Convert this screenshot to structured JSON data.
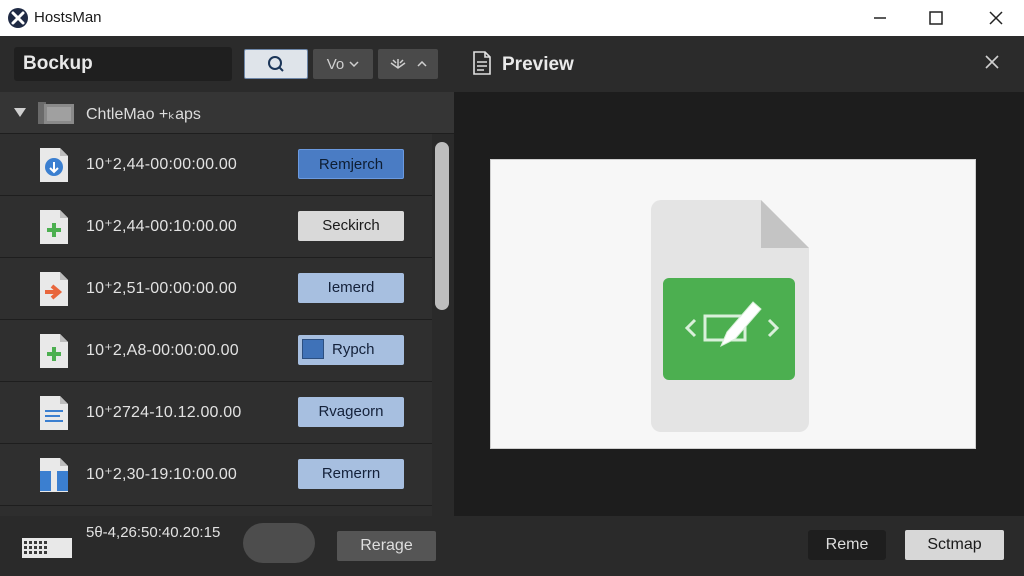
{
  "window": {
    "title": "HostsMan",
    "controls": [
      "minimize-icon",
      "maximize-icon",
      "close-icon"
    ]
  },
  "toolbar": {
    "title_field_value": "Bockup",
    "search_icon": "search-icon",
    "filter_label": "Vo",
    "sort_icon": "sort-icon"
  },
  "group": {
    "label": "ChtleMao +ₖaps",
    "icon": "folder-icon",
    "expanded": true
  },
  "rows": [
    {
      "time": "10⁺2,44-00:00:00.00",
      "action": "Remjerch",
      "icon": "download-file-icon",
      "style": "primary"
    },
    {
      "time": "10⁺2,44-00:10:00.00",
      "action": "Seckirch",
      "icon": "add-file-icon",
      "style": "light"
    },
    {
      "time": "10⁺2,51-00:00:00.00",
      "action": "Iemerd",
      "icon": "forward-file-icon",
      "style": "blue"
    },
    {
      "time": "10⁺2,A8-00:00:00.00",
      "action": "Rypch",
      "icon": "add-file-icon",
      "style": "check"
    },
    {
      "time": "10⁺2724-10.12.00.00",
      "action": "Rvageorn",
      "icon": "text-file-icon",
      "style": "blue"
    },
    {
      "time": "10⁺2,30-19:10:00.00",
      "action": "Remerrn",
      "icon": "archive-file-icon",
      "style": "blue"
    }
  ],
  "preview": {
    "title": "Preview",
    "icon": "document-icon",
    "file_icon": "code-edit-file-icon"
  },
  "statusbar": {
    "timestamp": "5θ-4,26:50:40.20:15",
    "merge_label": "Rerage",
    "rename_label": "Reme",
    "setup_label": "Sctmap"
  },
  "colors": {
    "accent_blue": "#4a7cc4",
    "green": "#4caf50",
    "orange": "#e8663c"
  }
}
